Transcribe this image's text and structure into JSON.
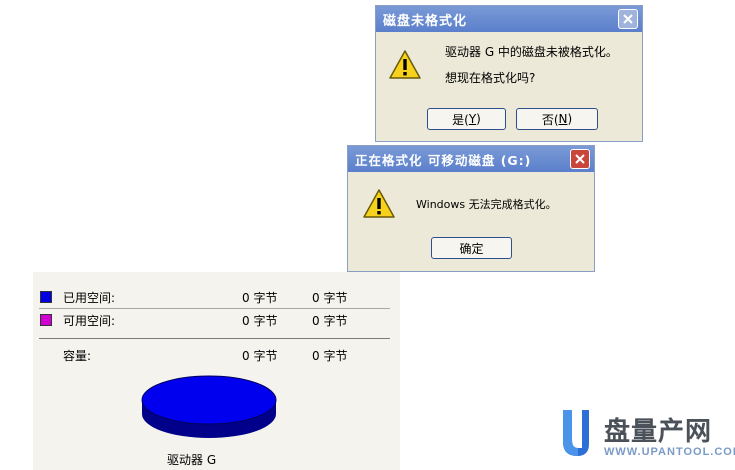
{
  "dialog1": {
    "title": "磁盘未格式化",
    "message_line1": "驱动器 G 中的磁盘未被格式化。",
    "message_line2": "想现在格式化吗?",
    "yes_label": "是(",
    "yes_key": "Y",
    "no_label": "否(",
    "no_key": "N"
  },
  "dialog2": {
    "title": "正在格式化 可移动磁盘 (G:)",
    "message": "Windows 无法完成格式化。",
    "ok_label": "确定"
  },
  "properties": {
    "used": {
      "label": "已用空间:",
      "bytes": "0 字节",
      "size": "0 字节",
      "color": "#0000e0"
    },
    "free": {
      "label": "可用空间:",
      "bytes": "0 字节",
      "size": "0 字节",
      "color": "#d000d0"
    },
    "capacity": {
      "label": "容量:",
      "bytes": "0 字节",
      "size": "0 字节"
    },
    "drive_label": "驱动器 G"
  },
  "watermark": {
    "brand": "盘量产网",
    "url": "WWW.UPANTOOL.COM"
  },
  "icons": {
    "warning": "warning-icon",
    "close": "close-icon",
    "logo": "upantool-logo-icon"
  }
}
